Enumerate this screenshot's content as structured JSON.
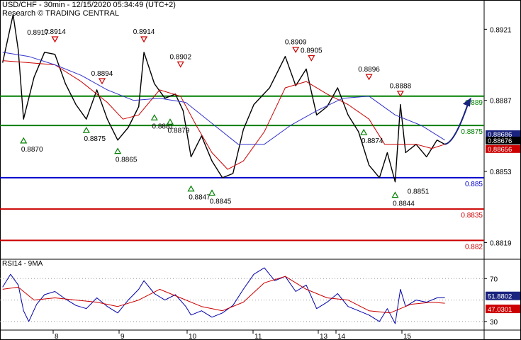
{
  "header": {
    "line1": "USD/CHF - 30min - 12/15/2020 05:34:49 (UTC+2)",
    "line2": "Research © TRADING CENTRAL"
  },
  "colors": {
    "support": "#008000",
    "resistance": "#cc0000",
    "pivot": "#0000cc",
    "price": "#000000",
    "ma_fast": "#cc0000",
    "ma_slow": "#3333cc",
    "arrow": "#1a237e",
    "rsi": "#0000aa",
    "rsi_ma": "#cc0000",
    "tag_blue": "#1a237e",
    "tag_black": "#000000",
    "tag_red": "#cc0000"
  },
  "chart_data": [
    {
      "type": "line",
      "title": "USD/CHF - 30min",
      "ylim": [
        0.8811,
        0.8935
      ],
      "x_ticks": [
        "8",
        "9",
        "10",
        "11",
        "13",
        "14",
        "15"
      ],
      "y_ticks": [
        "0.8921",
        "0.8887",
        "0.8853",
        "0.8819"
      ],
      "levels": [
        {
          "label": "0.889",
          "value": 0.8889,
          "color": "#008000"
        },
        {
          "label": "0.8875",
          "value": 0.8875,
          "color": "#008000"
        },
        {
          "label": "0.885",
          "value": 0.885,
          "color": "#0000cc"
        },
        {
          "label": "0.8835",
          "value": 0.8835,
          "color": "#cc0000"
        },
        {
          "label": "0.882",
          "value": 0.882,
          "color": "#cc0000"
        }
      ],
      "price_tags": [
        {
          "label": "0.88686",
          "value": 0.88686,
          "color": "#1a237e"
        },
        {
          "label": "0.88676",
          "value": 0.88676,
          "color": "#000000"
        },
        {
          "label": "0.88656",
          "value": 0.88656,
          "color": "#cc0000"
        }
      ],
      "highs": [
        {
          "label": "0.8914",
          "t": 8.0,
          "value": 0.8914
        },
        {
          "label": "0.8914",
          "t": 9.7,
          "value": 0.8914
        },
        {
          "label": "0.8894",
          "t": 8.9,
          "value": 0.8894
        },
        {
          "label": "0.8902",
          "t": 10.4,
          "value": 0.8902
        },
        {
          "label": "0.8909",
          "t": 12.6,
          "value": 0.8909
        },
        {
          "label": "0.8905",
          "t": 12.9,
          "value": 0.8905
        },
        {
          "label": "0.8896",
          "t": 14.0,
          "value": 0.8896
        },
        {
          "label": "0.8888",
          "t": 14.6,
          "value": 0.8888
        }
      ],
      "extra_high_label": "0.8917",
      "lows": [
        {
          "label": "0.8870",
          "t": 7.4,
          "value": 0.887
        },
        {
          "label": "0.8875",
          "t": 8.6,
          "value": 0.8875
        },
        {
          "label": "0.8865",
          "t": 9.2,
          "value": 0.8865
        },
        {
          "label": "0.8881",
          "t": 9.9,
          "value": 0.8881
        },
        {
          "label": "0.8879",
          "t": 10.2,
          "value": 0.8879
        },
        {
          "label": "0.8847",
          "t": 10.6,
          "value": 0.8847
        },
        {
          "label": "0.8845",
          "t": 11.0,
          "value": 0.8845
        },
        {
          "label": "0.8874",
          "t": 13.9,
          "value": 0.8874
        },
        {
          "label": "0.8844",
          "t": 14.5,
          "value": 0.8844
        }
      ],
      "note_label": "0.8851",
      "series": [
        {
          "name": "price",
          "t": [
            7.0,
            7.2,
            7.3,
            7.4,
            7.6,
            7.8,
            8.0,
            8.2,
            8.4,
            8.6,
            8.8,
            9.0,
            9.2,
            9.4,
            9.6,
            9.7,
            9.9,
            10.1,
            10.3,
            10.45,
            10.6,
            10.8,
            11.0,
            11.2,
            11.4,
            11.6,
            11.8,
            12.1,
            12.4,
            12.6,
            12.8,
            13.0,
            13.2,
            13.4,
            13.6,
            13.8,
            14.0,
            14.2,
            14.35,
            14.5,
            14.6,
            14.7,
            14.9,
            15.1,
            15.3,
            15.45
          ],
          "value": [
            0.8905,
            0.8928,
            0.8911,
            0.8878,
            0.8898,
            0.891,
            0.8909,
            0.8895,
            0.8885,
            0.8878,
            0.8892,
            0.8878,
            0.8868,
            0.8874,
            0.8884,
            0.891,
            0.8895,
            0.8888,
            0.889,
            0.8882,
            0.886,
            0.887,
            0.8858,
            0.885,
            0.8852,
            0.8873,
            0.8885,
            0.8893,
            0.8908,
            0.8894,
            0.8902,
            0.888,
            0.8884,
            0.8893,
            0.888,
            0.8872,
            0.8856,
            0.885,
            0.8862,
            0.8848,
            0.8885,
            0.8862,
            0.8866,
            0.886,
            0.8868,
            0.8866
          ]
        },
        {
          "name": "ma_fast",
          "t": [
            7.0,
            7.5,
            8.0,
            8.5,
            9.0,
            9.3,
            9.6,
            10.0,
            10.4,
            10.7,
            11.0,
            11.3,
            11.6,
            12.0,
            12.4,
            12.8,
            13.2,
            13.6,
            14.0,
            14.3,
            14.6,
            14.9,
            15.2,
            15.45
          ],
          "value": [
            0.8906,
            0.8905,
            0.8904,
            0.8896,
            0.8886,
            0.8878,
            0.888,
            0.8892,
            0.8889,
            0.8875,
            0.8862,
            0.8854,
            0.8858,
            0.8872,
            0.8893,
            0.8896,
            0.889,
            0.8885,
            0.8878,
            0.8866,
            0.8866,
            0.8866,
            0.8864,
            0.8866
          ]
        },
        {
          "name": "ma_slow",
          "t": [
            7.0,
            7.5,
            8.0,
            8.5,
            9.0,
            9.5,
            10.0,
            10.5,
            11.0,
            11.5,
            12.0,
            12.5,
            13.0,
            13.5,
            14.0,
            14.5,
            15.0,
            15.45
          ],
          "value": [
            0.891,
            0.8908,
            0.8904,
            0.8899,
            0.8892,
            0.8887,
            0.8888,
            0.8886,
            0.8876,
            0.8866,
            0.8866,
            0.8875,
            0.8882,
            0.8888,
            0.8889,
            0.888,
            0.8875,
            0.8868
          ]
        }
      ],
      "forecast_arrow": {
        "t_start": 15.45,
        "value_start": 0.8866,
        "t_end": 15.9,
        "value_end": 0.8886
      }
    },
    {
      "type": "line",
      "title": "RSI14 - 9MA",
      "ylim": [
        22,
        88
      ],
      "y_ticks": [
        "70",
        "30"
      ],
      "value_tags": [
        {
          "label": "51.8802",
          "value": 51.8802,
          "color": "#1a237e"
        },
        {
          "label": "47.0301",
          "value": 47.0301,
          "color": "#cc0000"
        }
      ],
      "series": [
        {
          "name": "rsi",
          "t": [
            7.0,
            7.15,
            7.3,
            7.4,
            7.5,
            7.65,
            7.8,
            8.0,
            8.2,
            8.4,
            8.6,
            8.8,
            9.0,
            9.2,
            9.4,
            9.6,
            9.7,
            9.9,
            10.1,
            10.3,
            10.5,
            10.6,
            10.8,
            11.0,
            11.2,
            11.4,
            11.6,
            11.8,
            12.0,
            12.2,
            12.4,
            12.6,
            12.8,
            13.0,
            13.2,
            13.4,
            13.6,
            13.8,
            14.0,
            14.2,
            14.35,
            14.5,
            14.6,
            14.7,
            14.9,
            15.1,
            15.3,
            15.45
          ],
          "value": [
            62,
            74,
            64,
            40,
            30,
            46,
            55,
            58,
            51,
            45,
            42,
            52,
            44,
            38,
            50,
            60,
            68,
            56,
            50,
            55,
            44,
            36,
            40,
            34,
            38,
            45,
            60,
            74,
            80,
            68,
            72,
            58,
            64,
            42,
            48,
            56,
            44,
            40,
            36,
            30,
            42,
            28,
            60,
            44,
            50,
            48,
            52,
            52
          ]
        },
        {
          "name": "rsi_ma",
          "t": [
            7.0,
            7.3,
            7.6,
            8.0,
            8.4,
            8.8,
            9.2,
            9.6,
            10.0,
            10.4,
            10.8,
            11.2,
            11.6,
            12.0,
            12.4,
            12.8,
            13.2,
            13.6,
            14.0,
            14.4,
            14.8,
            15.2,
            15.45
          ],
          "value": [
            60,
            62,
            50,
            52,
            50,
            48,
            44,
            50,
            60,
            52,
            44,
            40,
            48,
            66,
            72,
            60,
            52,
            50,
            40,
            38,
            46,
            48,
            47
          ]
        }
      ]
    }
  ]
}
